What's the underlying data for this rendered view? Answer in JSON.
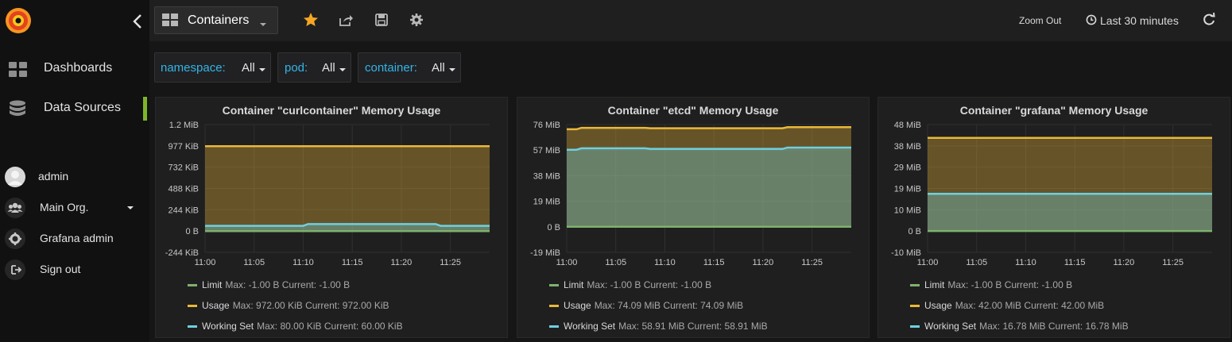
{
  "sidebar": {
    "nav": [
      {
        "label": "Dashboards",
        "icon": "dashboards-icon"
      },
      {
        "label": "Data Sources",
        "icon": "database-icon"
      }
    ],
    "user": [
      {
        "label": "admin",
        "icon": "avatar"
      },
      {
        "label": "Main Org.",
        "icon": "users-icon"
      },
      {
        "label": "Grafana admin",
        "icon": "gear-icon"
      },
      {
        "label": "Sign out",
        "icon": "sign-out-icon"
      }
    ]
  },
  "topbar": {
    "dashboard_title": "Containers",
    "zoom_out": "Zoom Out",
    "time_range": "Last 30 minutes"
  },
  "variables": [
    {
      "name": "namespace:",
      "value": "All"
    },
    {
      "name": "pod:",
      "value": "All"
    },
    {
      "name": "container:",
      "value": "All"
    }
  ],
  "colors": {
    "limit": "#7eb26d",
    "usage": "#eab839",
    "working_set": "#6ed0e0",
    "accent": "#7eb52a"
  },
  "chart_data": [
    {
      "type": "area",
      "title": "Container \"curlcontainer\" Memory Usage",
      "x": [
        "11:00",
        "11:05",
        "11:10",
        "11:15",
        "11:20",
        "11:25"
      ],
      "y_ticks": [
        "1.2 MiB",
        "977 KiB",
        "732 KiB",
        "488 KiB",
        "244 KiB",
        "0 B",
        "-244 KiB"
      ],
      "ylim": [
        -244,
        1220
      ],
      "x_range": [
        0,
        29
      ],
      "series": [
        {
          "name": "Limit",
          "max": "Max: -1.00 B",
          "current": "Current: -1.00 B",
          "points": [
            [
              0,
              -1
            ],
            [
              29,
              -1
            ]
          ]
        },
        {
          "name": "Usage",
          "max": "Max: 972.00 KiB",
          "current": "Current: 972.00 KiB",
          "points": [
            [
              0,
              972
            ],
            [
              29,
              972
            ]
          ]
        },
        {
          "name": "Working Set",
          "max": "Max: 80.00 KiB",
          "current": "Current: 60.00 KiB",
          "points": [
            [
              0,
              60
            ],
            [
              10,
              60
            ],
            [
              10.5,
              80
            ],
            [
              23.5,
              80
            ],
            [
              24,
              60
            ],
            [
              29,
              60
            ]
          ]
        }
      ]
    },
    {
      "type": "area",
      "title": "Container \"etcd\" Memory Usage",
      "x": [
        "11:00",
        "11:05",
        "11:10",
        "11:15",
        "11:20",
        "11:25"
      ],
      "y_ticks": [
        "76 MiB",
        "57 MiB",
        "38 MiB",
        "19 MiB",
        "0 B",
        "-19 MiB"
      ],
      "ylim": [
        -19,
        76
      ],
      "x_range": [
        0,
        29
      ],
      "series": [
        {
          "name": "Limit",
          "max": "Max: -1.00 B",
          "current": "Current: -1.00 B",
          "points": [
            [
              0,
              0
            ],
            [
              29,
              0
            ]
          ]
        },
        {
          "name": "Usage",
          "max": "Max: 74.09 MiB",
          "current": "Current: 74.09 MiB",
          "points": [
            [
              0,
              72.5
            ],
            [
              1,
              72.5
            ],
            [
              1.5,
              73.6
            ],
            [
              8,
              73.6
            ],
            [
              8.5,
              73.3
            ],
            [
              22,
              73.3
            ],
            [
              22.5,
              74.09
            ],
            [
              29,
              74.09
            ]
          ]
        },
        {
          "name": "Working Set",
          "max": "Max: 58.91 MiB",
          "current": "Current: 58.91 MiB",
          "points": [
            [
              0,
              57.3
            ],
            [
              1,
              57.3
            ],
            [
              1.5,
              58.4
            ],
            [
              8,
              58.4
            ],
            [
              8.5,
              57.9
            ],
            [
              22,
              57.9
            ],
            [
              22.5,
              58.91
            ],
            [
              29,
              58.91
            ]
          ]
        }
      ]
    },
    {
      "type": "area",
      "title": "Container \"grafana\" Memory Usage",
      "x": [
        "11:00",
        "11:05",
        "11:10",
        "11:15",
        "11:20",
        "11:25"
      ],
      "y_ticks": [
        "48 MiB",
        "38 MiB",
        "29 MiB",
        "19 MiB",
        "10 MiB",
        "0 B",
        "-10 MiB"
      ],
      "ylim": [
        -9.6,
        48
      ],
      "x_range": [
        0,
        29
      ],
      "series": [
        {
          "name": "Limit",
          "max": "Max: -1.00 B",
          "current": "Current: -1.00 B",
          "points": [
            [
              0,
              0
            ],
            [
              29,
              0
            ]
          ]
        },
        {
          "name": "Usage",
          "max": "Max: 42.00 MiB",
          "current": "Current: 42.00 MiB",
          "points": [
            [
              0,
              42
            ],
            [
              29,
              42
            ]
          ]
        },
        {
          "name": "Working Set",
          "max": "Max: 16.78 MiB",
          "current": "Current: 16.78 MiB",
          "points": [
            [
              0,
              16.78
            ],
            [
              29,
              16.78
            ]
          ]
        }
      ]
    }
  ]
}
